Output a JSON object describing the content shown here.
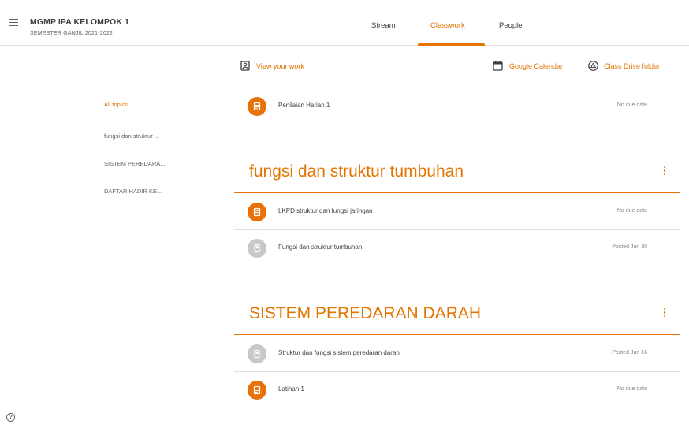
{
  "header": {
    "class_name": "MGMP IPA KELOMPOK 1",
    "semester": "SEMESTER GANJIL 2021-2022",
    "tabs": [
      {
        "label": "Stream"
      },
      {
        "label": "Classwork"
      },
      {
        "label": "People"
      }
    ],
    "active_tab": "Classwork"
  },
  "toolbar": {
    "view_work": "View your work",
    "google_calendar": "Google Calendar",
    "class_drive": "Class Drive folder"
  },
  "topics_nav": [
    {
      "label": "All topics",
      "active": true
    },
    {
      "label": "fungsi dan struktur ..."
    },
    {
      "label": "SISTEM PEREDARA..."
    },
    {
      "label": "DAFTAR HADIR KE..."
    }
  ],
  "ungrouped": [
    {
      "title": "Penilaian Harian 1",
      "meta": "No due date",
      "icon": "assignment-icon"
    }
  ],
  "sections": [
    {
      "heading": "fungsi dan struktur tumbuhan",
      "items": [
        {
          "title": "LKPD struktur dan fungsi jaringan",
          "meta": "No due date",
          "icon": "assignment-icon"
        },
        {
          "title": "Fungsi dan struktur tumbuhan",
          "meta": "Posted Jun 30",
          "icon": "material-icon"
        }
      ]
    },
    {
      "heading": "SISTEM PEREDARAN DARAH",
      "items": [
        {
          "title": "Struktur dan fungsi sistem peredaran darah",
          "meta": "Posted Jun 16",
          "icon": "material-icon"
        },
        {
          "title": "Latihan 1",
          "meta": "No due date",
          "icon": "assignment-icon"
        }
      ]
    }
  ],
  "help_glyph": "?",
  "colors": {
    "accent": "#e37400",
    "assignment": "#e8710a",
    "material": "#c8c8c8"
  }
}
